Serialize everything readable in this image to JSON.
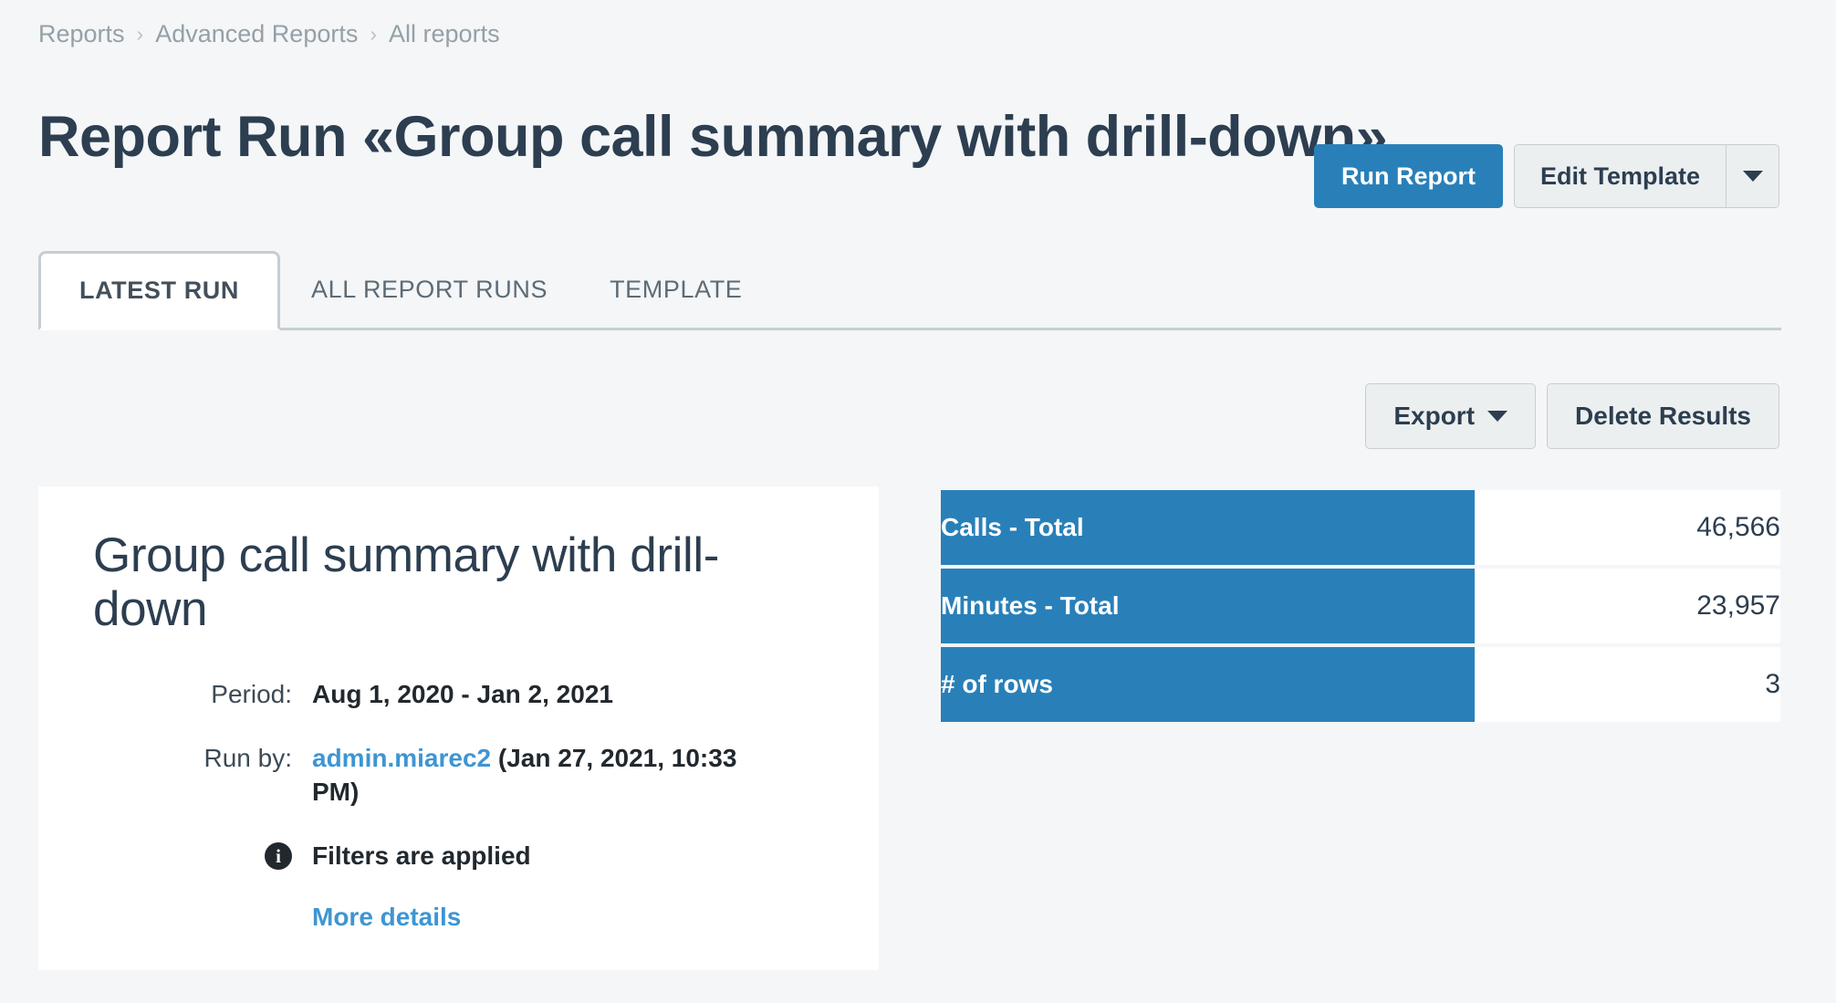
{
  "breadcrumb": {
    "items": [
      {
        "label": "Reports"
      },
      {
        "label": "Advanced Reports"
      },
      {
        "label": "All reports"
      }
    ],
    "separator": "›"
  },
  "header": {
    "title": "Report Run «Group call summary with drill-down»",
    "actions": {
      "run_report_label": "Run Report",
      "edit_template_label": "Edit Template",
      "dropdown_icon": "chevron-down-icon"
    }
  },
  "tabs": [
    {
      "label": "LATEST RUN",
      "active": true
    },
    {
      "label": "ALL REPORT RUNS",
      "active": false
    },
    {
      "label": "TEMPLATE",
      "active": false
    }
  ],
  "results_toolbar": {
    "export_label": "Export",
    "export_caret_icon": "chevron-down-icon",
    "delete_results_label": "Delete Results"
  },
  "info_card": {
    "title": "Group call summary with drill-down",
    "details": [
      {
        "label": "Period:",
        "value": "Aug 1, 2020 - Jan 2, 2021"
      },
      {
        "label": "Run by:",
        "user": "admin.miarec2",
        "value": " (Jan 27, 2021, 10:33 PM)"
      },
      {
        "icon": "info-circle-icon",
        "icon_glyph": "i",
        "value": "Filters are applied"
      }
    ],
    "more_details_label": "More details"
  },
  "stats": {
    "rows": [
      {
        "label": "Calls - Total",
        "value": "46,566"
      },
      {
        "label": "Minutes - Total",
        "value": "23,957"
      },
      {
        "label": "# of rows",
        "value": "3"
      }
    ]
  },
  "colors": {
    "accent": "#2980b9",
    "link": "#3e95d3",
    "text_dark": "#2c3e50",
    "page_bg": "#f4f6f7",
    "button_bg": "#eceff0",
    "border": "#c6ced3"
  }
}
